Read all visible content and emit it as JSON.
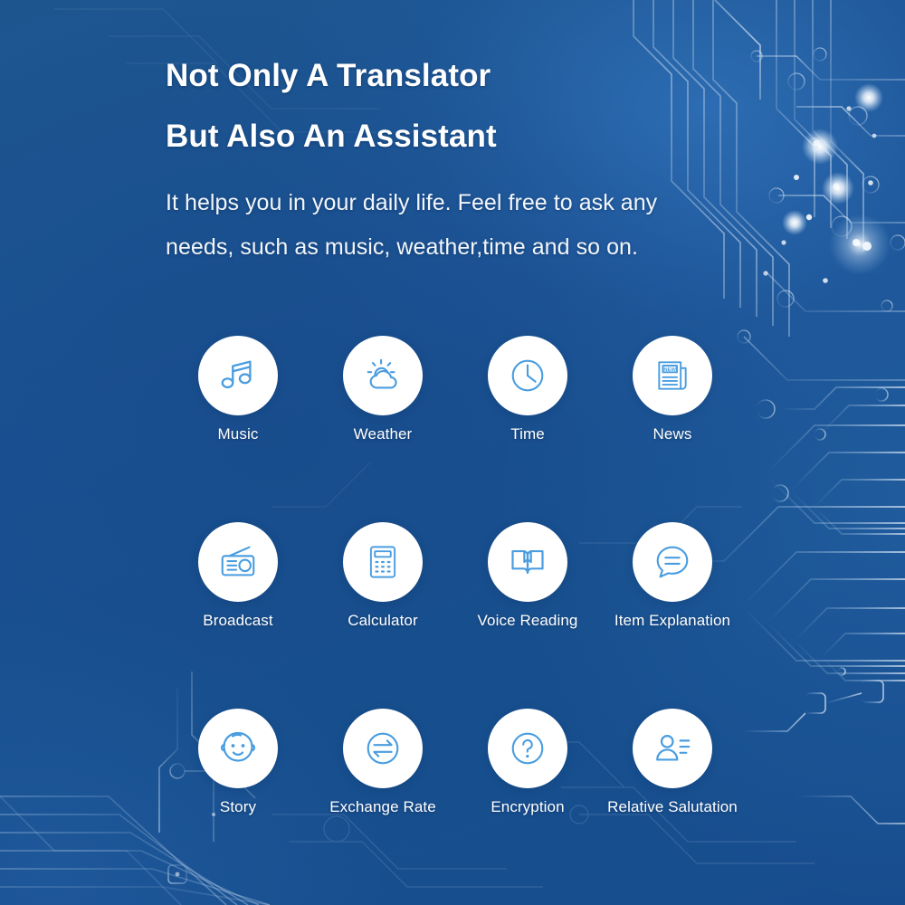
{
  "hero": {
    "headline_line1": "Not Only A Translator",
    "headline_line2": "But Also An Assistant",
    "subtitle_line1": "It helps you in your daily life. Feel free to ask any",
    "subtitle_line2": "needs, such as music, weather,time and so on."
  },
  "colors": {
    "background_blue": "#1a5193",
    "background_blue_light": "#2d6cb2",
    "disc_white": "#ffffff",
    "icon_blue": "#4a9de0",
    "text_white": "#ffffff",
    "circuit_trace": "#bcd6ef"
  },
  "features": [
    {
      "label": "Music",
      "icon": "music-note-icon",
      "row": 0,
      "col": 0
    },
    {
      "label": "Weather",
      "icon": "sun-cloud-icon",
      "row": 0,
      "col": 1
    },
    {
      "label": "Time",
      "icon": "clock-icon",
      "row": 0,
      "col": 2
    },
    {
      "label": "News",
      "icon": "newspaper-icon",
      "row": 0,
      "col": 3
    },
    {
      "label": "Broadcast",
      "icon": "radio-icon",
      "row": 1,
      "col": 0
    },
    {
      "label": "Calculator",
      "icon": "calculator-icon",
      "row": 1,
      "col": 1
    },
    {
      "label": "Voice Reading",
      "icon": "open-book-icon",
      "row": 1,
      "col": 2
    },
    {
      "label": "Item Explanation",
      "icon": "speech-bubble-icon",
      "row": 1,
      "col": 3
    },
    {
      "label": "Story",
      "icon": "baby-face-icon",
      "row": 2,
      "col": 0
    },
    {
      "label": "Exchange Rate",
      "icon": "exchange-arrows-icon",
      "row": 2,
      "col": 1
    },
    {
      "label": "Encryption",
      "icon": "question-mark-icon",
      "row": 2,
      "col": 2
    },
    {
      "label": "Relative Salutation",
      "icon": "person-list-icon",
      "row": 2,
      "col": 3
    }
  ],
  "news_icon_text": "NEW"
}
